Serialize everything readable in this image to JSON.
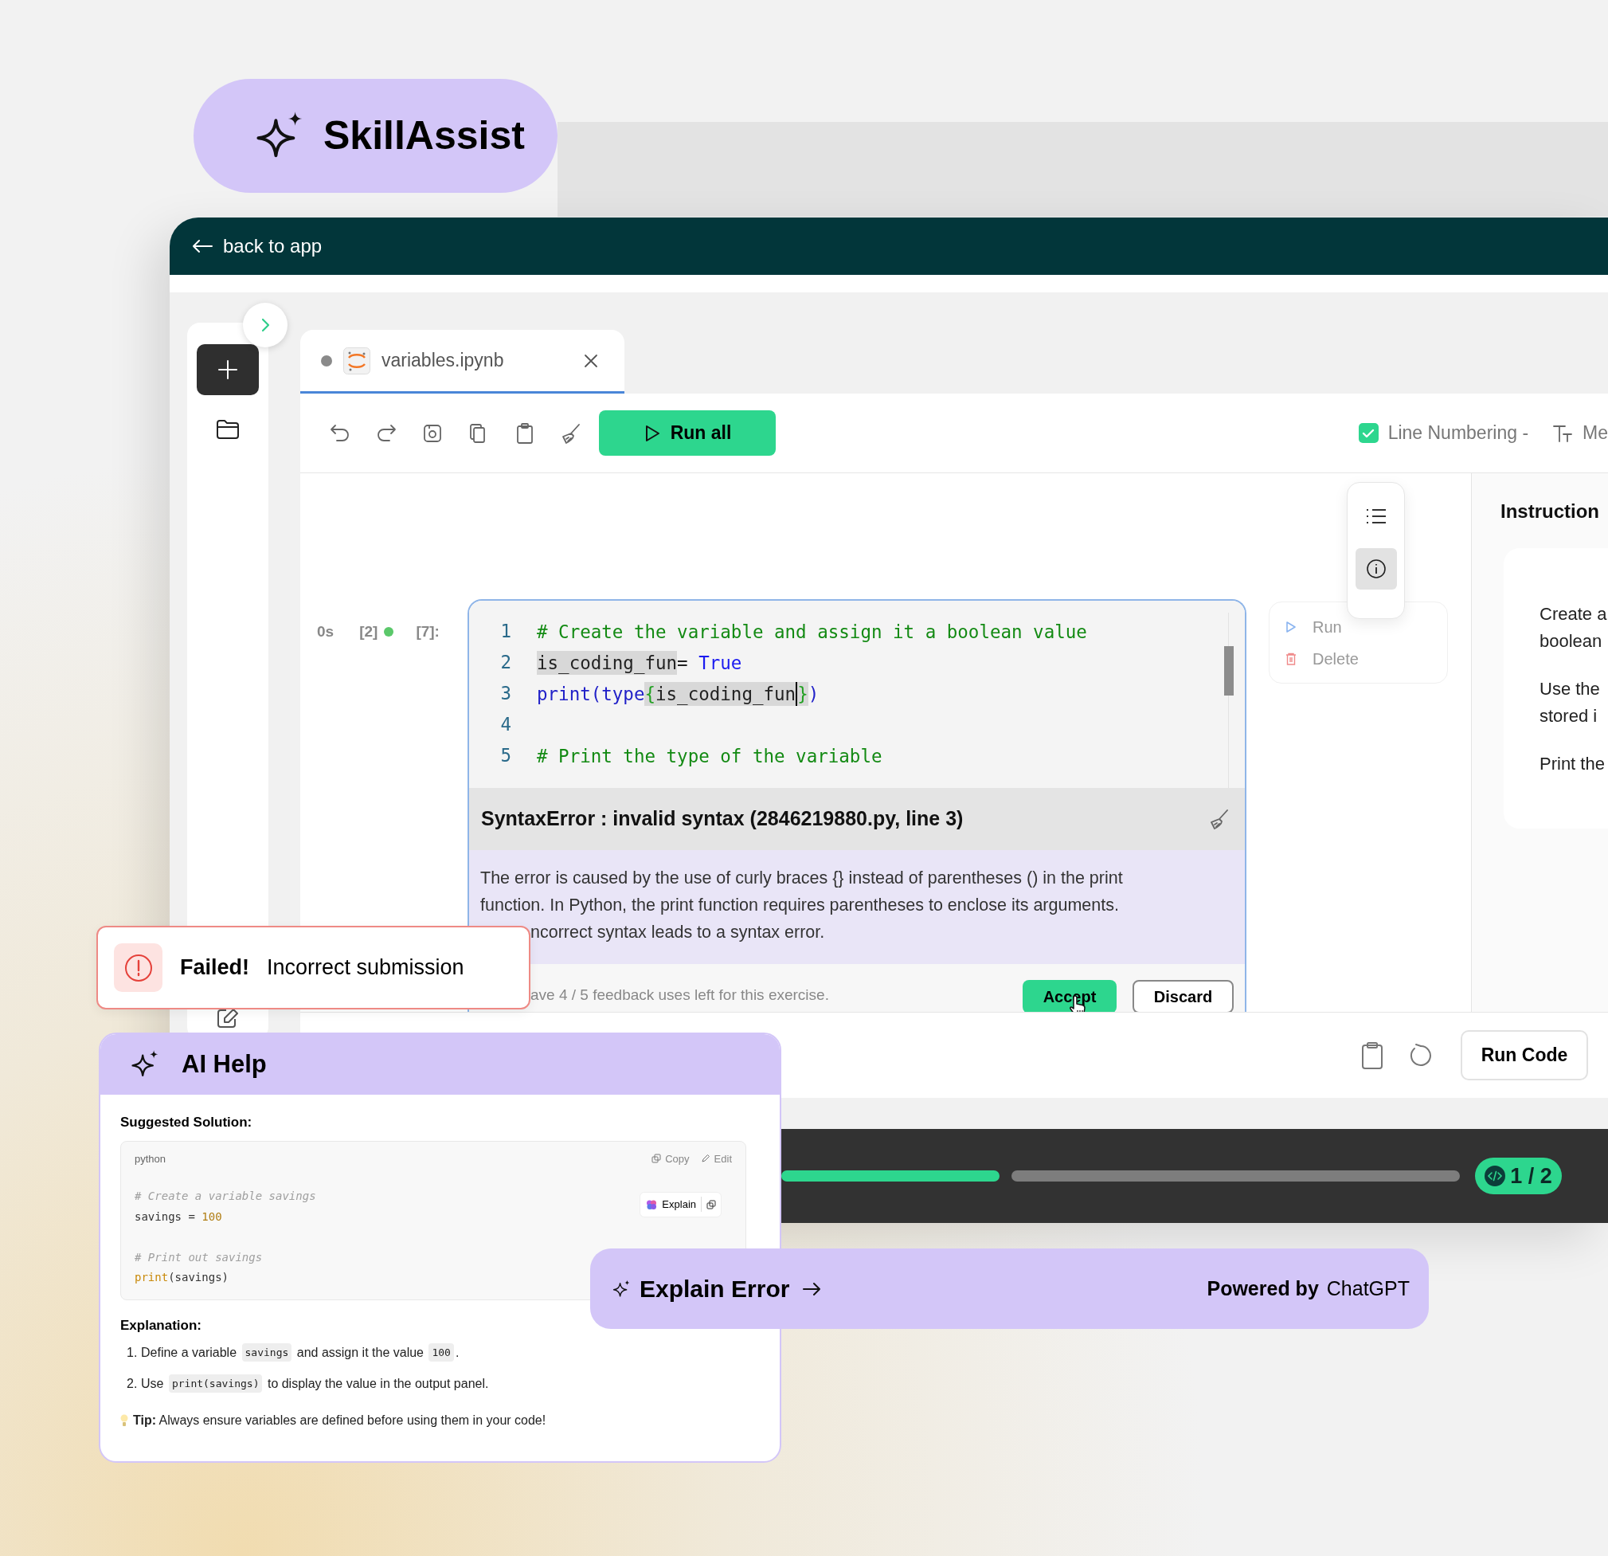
{
  "brand": {
    "name": "SkillAssist"
  },
  "app_bar": {
    "back_link": "back to app"
  },
  "tabs": [
    {
      "label": "variables.ipynb",
      "selected": true
    }
  ],
  "toolbar": {
    "run_all": "Run all",
    "line_numbering": {
      "label": "Line Numbering -",
      "checked": true
    },
    "cut_label": "Me"
  },
  "cell": {
    "time": "0s",
    "run_count": "[2]",
    "prompt": "[7]:",
    "lines": [
      {
        "number": "1",
        "kind": "code",
        "tokens": [
          {
            "text": "# Create the variable and assign it a boolean value",
            "kind": "comment",
            "highlighted": false
          }
        ]
      },
      {
        "number": "2",
        "kind": "code",
        "tokens": [
          {
            "text": "is_coding_fun",
            "kind": "name",
            "highlighted": true
          },
          {
            "text": "= ",
            "kind": "plain",
            "highlighted": false
          },
          {
            "text": "True",
            "kind": "keyword",
            "highlighted": false
          }
        ]
      },
      {
        "number": "3",
        "kind": "code",
        "tokens": [
          {
            "text": "print(type",
            "kind": "func",
            "highlighted": false
          },
          {
            "text": "{",
            "kind": "brace",
            "highlighted": true
          },
          {
            "text": "is_coding_fun",
            "kind": "name",
            "highlighted": true
          },
          {
            "kind": "cursor"
          },
          {
            "text": "}",
            "kind": "brace",
            "highlighted": true
          },
          {
            "text": ")",
            "kind": "func",
            "highlighted": false
          }
        ]
      },
      {
        "number": "4",
        "kind": "blank"
      },
      {
        "number": "5",
        "kind": "code",
        "tokens": [
          {
            "text": "# Print the type of the variable",
            "kind": "comment",
            "highlighted": false
          }
        ]
      }
    ],
    "error": {
      "title": "SyntaxError : invalid syntax (2846219880.py, line 3)",
      "explanation": [
        "The error is caused by the use of curly braces {} instead of parentheses () in the print",
        "function. In Python, the print function requires parentheses to enclose its arguments.",
        "ncorrect syntax leads to a syntax error."
      ]
    },
    "feedback_note": "ave 4 / 5 feedback uses left for this exercise.",
    "accept": "Accept",
    "discard": "Discard"
  },
  "side_tools": [
    {
      "kind": "list",
      "selected": false
    },
    {
      "kind": "info",
      "selected": true
    }
  ],
  "cell_menu": [
    {
      "kind": "run",
      "label": "Run"
    },
    {
      "kind": "delete",
      "label": "Delete"
    }
  ],
  "instructions": {
    "title": "Instruction",
    "lines": [
      "Create a",
      "boolean",
      "Use the",
      "stored i",
      "Print the"
    ]
  },
  "bottom_bar": {
    "run_code": "Run Code"
  },
  "progress": {
    "segments": [
      {
        "done": true
      },
      {
        "done": false
      }
    ],
    "badge": "1 / 2"
  },
  "toast": {
    "title": "Failed!",
    "message": "Incorrect submission"
  },
  "ai_help": {
    "title": "AI Help",
    "solution_heading": "Suggested Solution:",
    "language": "python",
    "copy": "Copy",
    "edit": "Edit",
    "explain": "Explain",
    "code": [
      {
        "kind": "code",
        "tokens": [
          {
            "text": "# Create a variable savings",
            "kind": "comment"
          }
        ]
      },
      {
        "kind": "code",
        "tokens": [
          {
            "text": "savings = ",
            "kind": "plain"
          },
          {
            "text": "100",
            "kind": "number"
          }
        ]
      },
      {
        "kind": "blank"
      },
      {
        "kind": "code",
        "tokens": [
          {
            "text": "# Print out savings",
            "kind": "comment"
          }
        ]
      },
      {
        "kind": "code",
        "tokens": [
          {
            "text": "print",
            "kind": "builtin"
          },
          {
            "text": "(savings)",
            "kind": "plain"
          }
        ]
      }
    ],
    "explanation_heading": "Explanation:",
    "steps": [
      {
        "number": "1.",
        "parts": [
          {
            "text": "Define a variable ",
            "kind": "text"
          },
          {
            "text": "savings",
            "kind": "code"
          },
          {
            "text": " and assign it the value ",
            "kind": "text"
          },
          {
            "text": "100",
            "kind": "code"
          },
          {
            "text": ".",
            "kind": "text"
          }
        ]
      },
      {
        "number": "2.",
        "parts": [
          {
            "text": "Use ",
            "kind": "text"
          },
          {
            "text": "print(savings)",
            "kind": "code"
          },
          {
            "text": " to display the value in the output panel.",
            "kind": "text"
          }
        ]
      }
    ],
    "tip": "**Tip:** Always ensure variables are defined before using them in your code!"
  },
  "explain_bar": {
    "label": "Explain Error",
    "powered_by": "Powered by",
    "provider": "ChatGPT"
  }
}
